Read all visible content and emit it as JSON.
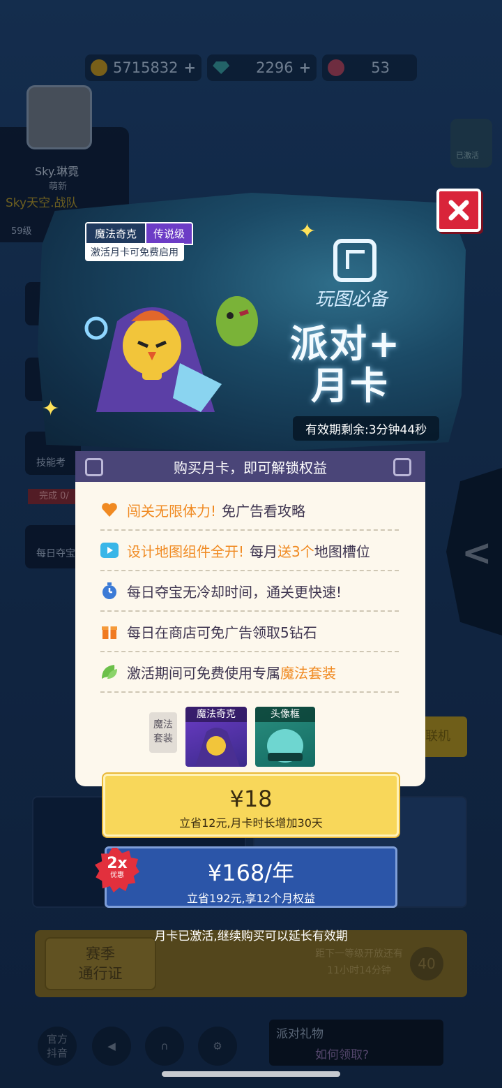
{
  "resources": {
    "coins": "5715832",
    "gems": "2296",
    "tickets": "53"
  },
  "profile": {
    "name": "Sky.琳霓",
    "rank": "萌新",
    "team": "Sky天空.战队",
    "level": "59级"
  },
  "background": {
    "skill_label": "技能考",
    "daily_done": "完成 0/",
    "daily_label": "每日夺宝",
    "online_button": "联机",
    "season_pass": "赛季\n通行证",
    "season_next": "距下一等级开放还有\n11小时14分钟",
    "season_level": "40",
    "bottom_douyin": "官方\n抖音",
    "gift_title": "派对礼物",
    "gift_link": "如何领取?",
    "badge_label": "已激活"
  },
  "banner": {
    "tag_name": "魔法奇克",
    "tag_rarity": "传说级",
    "tag_hint": "激活月卡可免费启用",
    "script_text": "玩图必备",
    "title_line1": "派对+",
    "title_line2": "月卡",
    "timer": "有效期剩余:3分钟44秒"
  },
  "card": {
    "header": "购买月卡，即可解锁权益",
    "benefits": [
      {
        "icon": "heart-icon",
        "highlight": "闯关无限体力!",
        "text": "免广告看攻略",
        "tail_highlight": "",
        "tail": ""
      },
      {
        "icon": "play-icon",
        "highlight": "设计地图组件全开!",
        "text": "每月",
        "tail_highlight": "送3个",
        "tail": "地图槽位"
      },
      {
        "icon": "stopwatch-icon",
        "highlight": "",
        "text": "每日夺宝无冷却时间，通关更快速!",
        "tail_highlight": "",
        "tail": ""
      },
      {
        "icon": "gift-icon",
        "highlight": "",
        "text": "每日在商店可免广告领取5钻石",
        "tail_highlight": "",
        "tail": ""
      },
      {
        "icon": "leaf-icon",
        "highlight": "",
        "text": "激活期间可免费使用专属",
        "tail_highlight": "魔法套装",
        "tail": ""
      }
    ],
    "set_label": "魔法\n套装",
    "item_costume": "魔法奇克",
    "item_frame": "头像框"
  },
  "purchase": {
    "monthly_price": "¥18",
    "monthly_desc": "立省12元,月卡时长增加30天",
    "yearly_price": "¥168/年",
    "yearly_desc": "立省192元,享12个月权益",
    "badge_main": "2x",
    "badge_sub": "优惠",
    "note": "月卡已激活,继续购买可以延长有效期"
  },
  "colors": {
    "accent_orange": "#f08a22",
    "close_red": "#d9243a",
    "monthly_yellow": "#f8d75a",
    "yearly_blue": "#2b55a8",
    "header_purple": "#4a4578"
  }
}
